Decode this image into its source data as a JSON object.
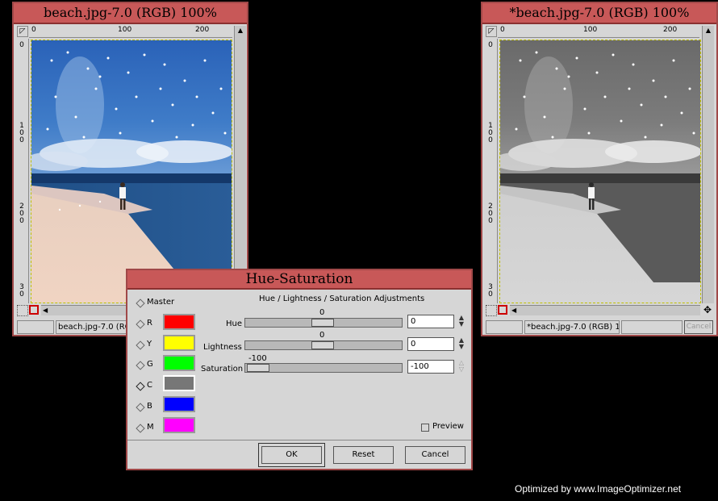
{
  "left_window": {
    "title": "beach.jpg-7.0 (RGB) 100%",
    "ruler_h": [
      "0",
      "100",
      "200"
    ],
    "ruler_v": [
      "0",
      "1\n0\n0",
      "2\n0\n0",
      "3\n0"
    ],
    "status_text": "beach.jpg-7.0 (RGB) 1"
  },
  "right_window": {
    "title": "*beach.jpg-7.0 (RGB) 100%",
    "ruler_h": [
      "0",
      "100",
      "200"
    ],
    "ruler_v": [
      "0",
      "1\n0\n0",
      "2\n0\n0",
      "3\n0"
    ],
    "status_text": "*beach.jpg-7.0 (RGB) 1",
    "cancel_label": "Cancel"
  },
  "dialog": {
    "title": "Hue-Saturation",
    "heading": "Hue / Lightness / Saturation Adjustments",
    "channels": [
      {
        "label": "Master",
        "color": ""
      },
      {
        "label": "R",
        "color": "#ff0000"
      },
      {
        "label": "Y",
        "color": "#ffff00"
      },
      {
        "label": "G",
        "color": "#00ff00"
      },
      {
        "label": "C",
        "color": "#777777"
      },
      {
        "label": "B",
        "color": "#0000ff"
      },
      {
        "label": "M",
        "color": "#ff00ff"
      }
    ],
    "hue": {
      "label": "Hue",
      "value_label": "0",
      "entry": "0",
      "value": 0
    },
    "lightness": {
      "label": "Lightness",
      "value_label": "0",
      "entry": "0",
      "value": 0
    },
    "saturation": {
      "label": "Saturation",
      "value_label": "-100",
      "entry": "-100",
      "value": -100
    },
    "preview_label": "Preview",
    "ok_label": "OK",
    "reset_label": "Reset",
    "cancel_label": "Cancel"
  },
  "watermark": "Optimized by www.ImageOptimizer.net"
}
